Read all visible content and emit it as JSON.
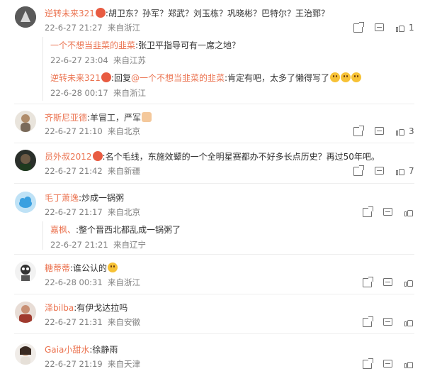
{
  "comments": [
    {
      "user": "逆转未来321",
      "text": ":胡卫东？孙军？郑武？刘玉栋？巩晓彬？巴特尔？王治郅？",
      "date": "22-6-27 21:27",
      "source": "来自浙江",
      "likes": "1",
      "replies": [
        {
          "user": "一个不想当韭菜的韭菜",
          "text": ":张卫平指导可有一席之地？",
          "date": "22-6-27 23:04",
          "source": "来自江苏"
        },
        {
          "user": "逆转未来321",
          "text_prefix": ":回复",
          "mention": "@一个不想当韭菜的韭菜",
          "text": ":肯定有吧，太多了懒得写了",
          "date": "22-6-28 00:17",
          "source": "来自浙江"
        }
      ]
    },
    {
      "user": "齐斯尼亚德",
      "text": ":羊冒工，严军",
      "date": "22-6-27 21:10",
      "source": "来自北京",
      "likes": "3"
    },
    {
      "user": "员外叔2012",
      "text": ":名个毛线，东施效颦的一个全明星赛都办不好多长点历史？再过50年吧。",
      "date": "22-6-27 21:42",
      "source": "来自新疆",
      "likes": "7"
    },
    {
      "user": "毛丁萧逸",
      "text": ":炒成一锅粥",
      "date": "22-6-27 21:17",
      "source": "来自北京",
      "likes": "",
      "replies": [
        {
          "user": "嘉枫、",
          "text": ":整个晋西北都乱成一锅粥了",
          "date": "22-6-27 21:21",
          "source": "来自辽宁"
        }
      ]
    },
    {
      "user": "糖蒂蒂",
      "text": ":谁公认的",
      "date": "22-6-28 00:31",
      "source": "来自浙江",
      "likes": ""
    },
    {
      "user": "泽bilba",
      "text": ":有伊戈达拉吗",
      "date": "22-6-27 21:31",
      "source": "来自安徽",
      "likes": ""
    },
    {
      "user": "Gaia小甜水",
      "text": ":徐静雨",
      "date": "22-6-27 21:19",
      "source": "来自天津",
      "likes": ""
    }
  ],
  "colors": {
    "nickname": "#eb7350",
    "meta": "#808080",
    "icon": "#6f6f6f"
  },
  "icons": {
    "forward": "forward-icon",
    "comment": "comment-icon",
    "like": "like-icon"
  }
}
